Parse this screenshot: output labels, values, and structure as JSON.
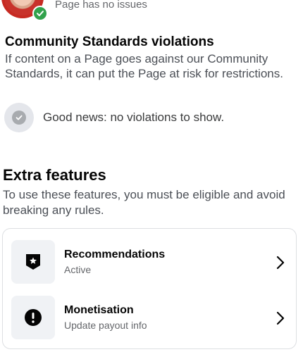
{
  "status": {
    "text": "Page has no issues"
  },
  "community_standards": {
    "title": "Community Standards violations",
    "description": "If content on a Page goes against our Community Standards, it can put the Page at risk for restrictions.",
    "violations_text": "Good news: no violations to show."
  },
  "extra_features": {
    "title": "Extra features",
    "description": "To use these features, you must be eligible and avoid breaking any rules.",
    "items": [
      {
        "title": "Recommendations",
        "subtitle": "Active",
        "icon": "star-badge-icon"
      },
      {
        "title": "Monetisation",
        "subtitle": "Update payout info",
        "icon": "exclamation-circle-icon"
      }
    ]
  },
  "colors": {
    "success_green": "#31a24c",
    "secondary_text": "#65676b",
    "card_border": "#dddfe2"
  }
}
